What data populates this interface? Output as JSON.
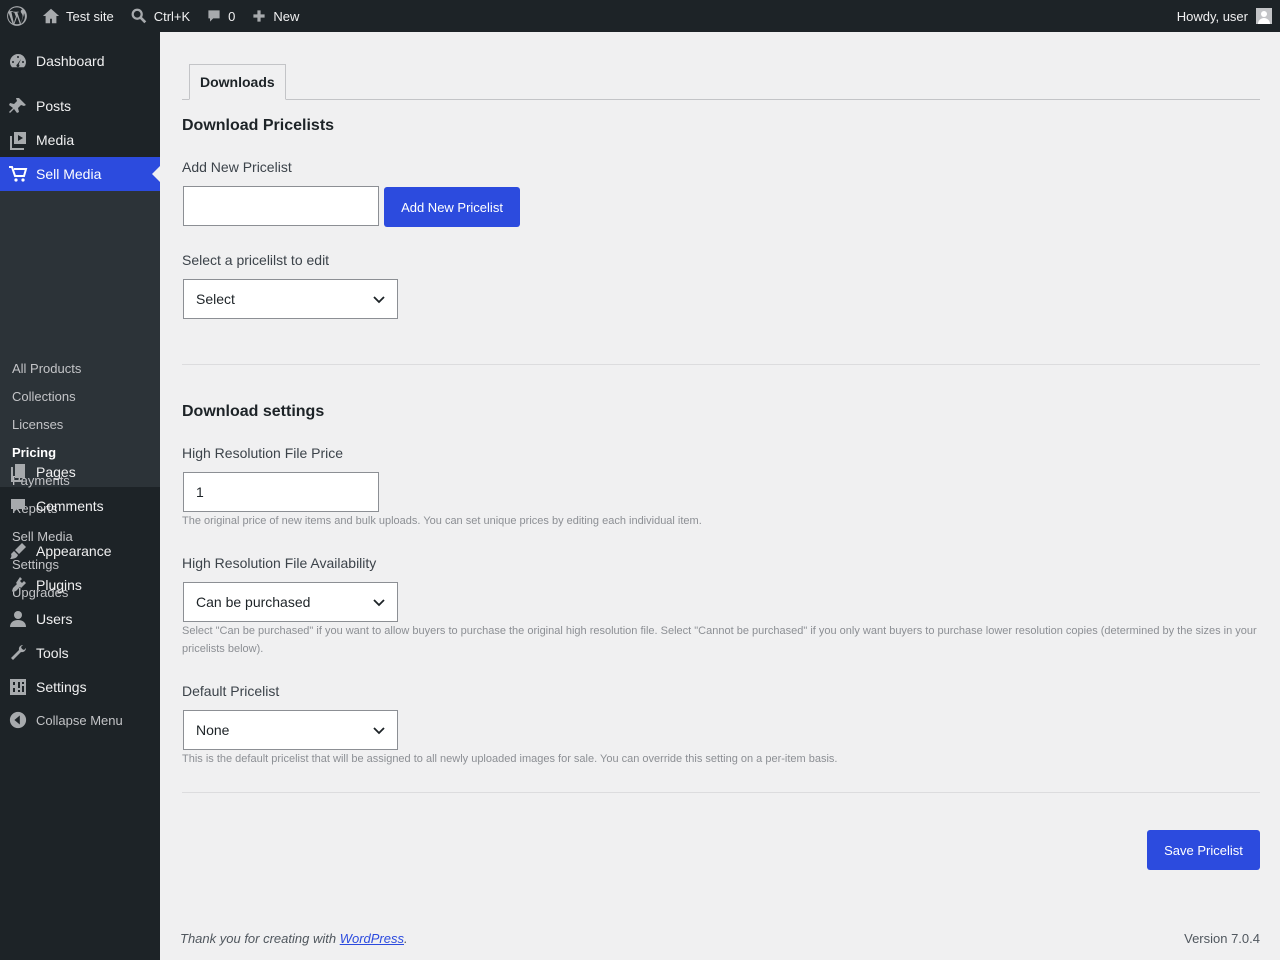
{
  "adminbar": {
    "site_name": "Test site",
    "search_shortcut": "Ctrl+K",
    "comments_count": "0",
    "new_label": "New",
    "howdy": "Howdy, user"
  },
  "sidebar": {
    "items": [
      {
        "label": "Dashboard",
        "icon": "dashboard-icon"
      },
      {
        "label": "Posts",
        "icon": "pin-icon"
      },
      {
        "label": "Media",
        "icon": "media-icon"
      },
      {
        "label": "Sell Media",
        "icon": "cart-icon"
      },
      {
        "label": "Pages",
        "icon": "pages-icon"
      },
      {
        "label": "Comments",
        "icon": "comment-icon"
      },
      {
        "label": "Appearance",
        "icon": "brush-icon"
      },
      {
        "label": "Plugins",
        "icon": "plugin-icon"
      },
      {
        "label": "Users",
        "icon": "user-icon"
      },
      {
        "label": "Tools",
        "icon": "wrench-icon"
      },
      {
        "label": "Settings",
        "icon": "sliders-icon"
      }
    ],
    "submenu": [
      "All Products",
      "Collections",
      "Licenses",
      "Pricing",
      "Payments",
      "Reports",
      "Sell Media",
      "Settings",
      "Upgrades"
    ],
    "collapse_label": "Collapse Menu"
  },
  "main": {
    "tab_label": "Downloads",
    "pricelists_heading": "Download Pricelists",
    "add_new_label": "Add New Pricelist",
    "add_new_input_value": "",
    "add_new_button": "Add New Pricelist",
    "select_label": "Select a pricelilst to edit",
    "select_value": "Select",
    "settings_heading": "Download settings",
    "hires_price_label": "High Resolution File Price",
    "hires_price_value": "1",
    "hires_price_desc": "The original price of new items and bulk uploads. You can set unique prices by editing each individual item.",
    "availability_label": "High Resolution File Availability",
    "availability_value": "Can be purchased",
    "availability_desc_1": "Select \"Can be purchased\" if you want to allow buyers to purchase the original high resolution file. Select \"Cannot be purchased\" if you only want buyers to purchase lower resolution copies (determined by the sizes in your",
    "availability_desc_2": "pricelists below).",
    "default_pricelist_label": "Default Pricelist",
    "default_pricelist_value": "None",
    "default_pricelist_desc": "This is the default pricelist that will be assigned to all newly uploaded images for sale. You can override this setting on a per-item basis.",
    "save_button": "Save Pricelist"
  },
  "footer": {
    "thanks_prefix": "Thank you for creating with ",
    "wordpress_link": "WordPress",
    "thanks_suffix": ".",
    "version": "Version 7.0.4"
  },
  "colors": {
    "accent": "#2c4bde",
    "sidebar_bg": "#1d2327",
    "submenu_bg": "#2c3338",
    "page_bg": "#f0f0f1"
  }
}
